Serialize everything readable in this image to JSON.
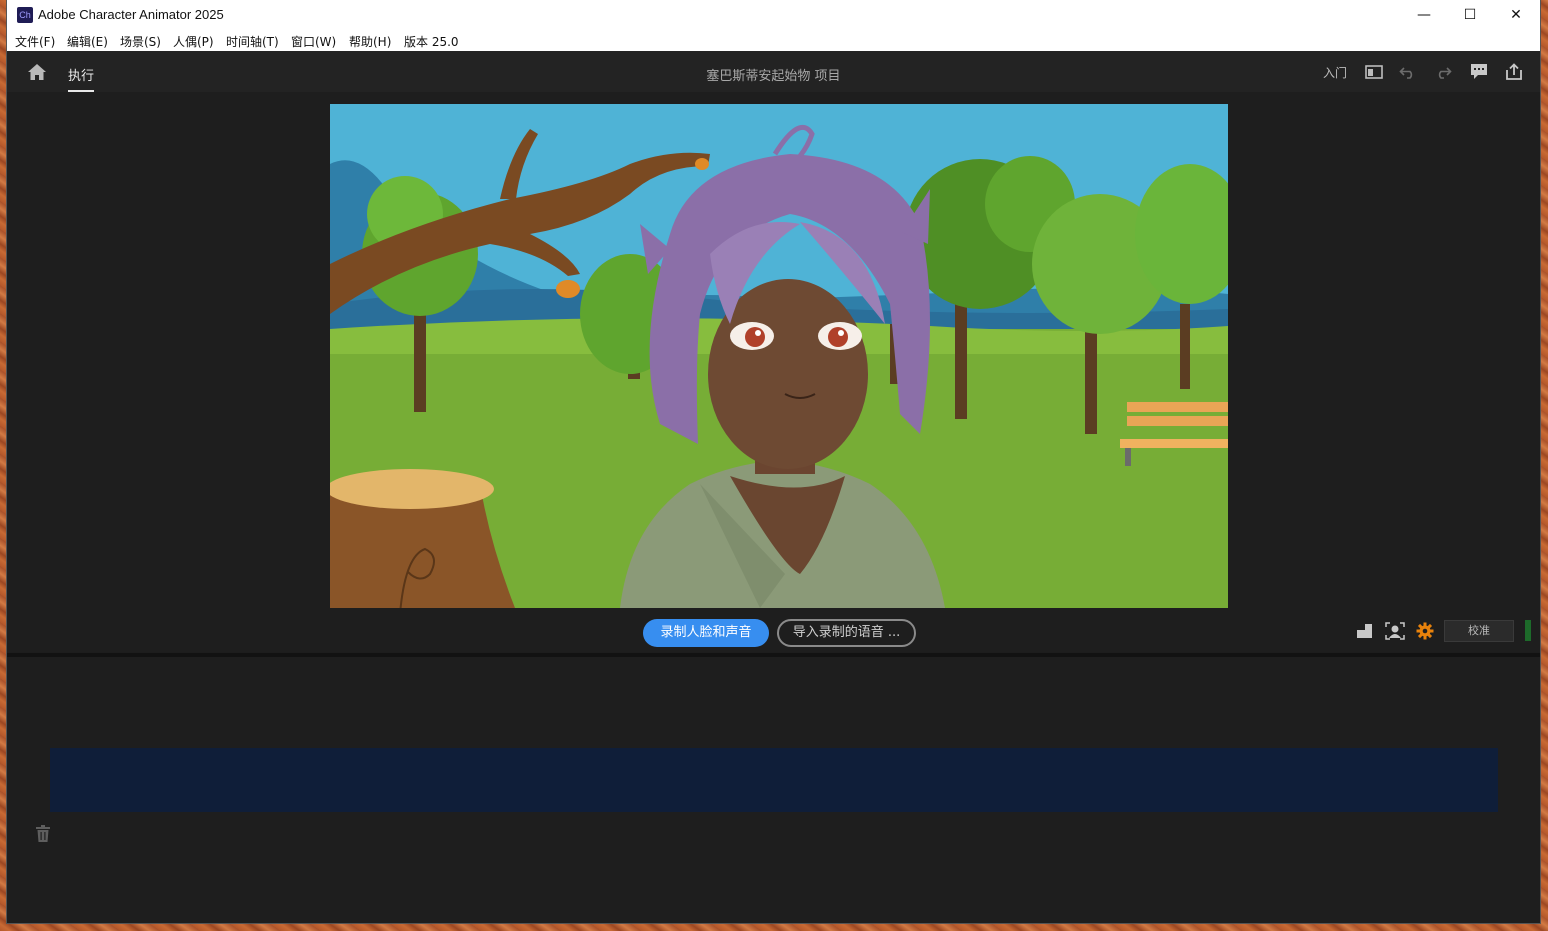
{
  "window": {
    "title": "Adobe Character Animator 2025",
    "app_icon_label": "Ch",
    "minimize_glyph": "—",
    "maximize_glyph": "☐",
    "close_glyph": "✕"
  },
  "menu": {
    "items": [
      {
        "label": "文件(F)"
      },
      {
        "label": "编辑(E)"
      },
      {
        "label": "场景(S)"
      },
      {
        "label": "人偶(P)"
      },
      {
        "label": "时间轴(T)"
      },
      {
        "label": "窗口(W)"
      },
      {
        "label": "帮助(H)"
      },
      {
        "label": "版本 25.0"
      }
    ]
  },
  "topbar": {
    "home_icon": "home-icon",
    "active_tab": "执行",
    "project_title": "塞巴斯蒂安起始物 项目",
    "getting_started": "入门",
    "icons": [
      "panel-layout-icon",
      "undo-icon",
      "redo-icon",
      "feedback-icon",
      "share-icon"
    ]
  },
  "stage": {
    "record_button": "录制人脸和声音",
    "import_button": "导入录制的语音 ...",
    "calibrate_button": "校准",
    "tool_icons": [
      "camera-input-icon",
      "face-tracking-icon",
      "settings-gear-icon"
    ],
    "accent_color": "#378ef0",
    "gear_color": "#e8820c"
  },
  "timeline": {
    "take_color": "#0f1e39",
    "trash_icon": "trash-icon"
  }
}
